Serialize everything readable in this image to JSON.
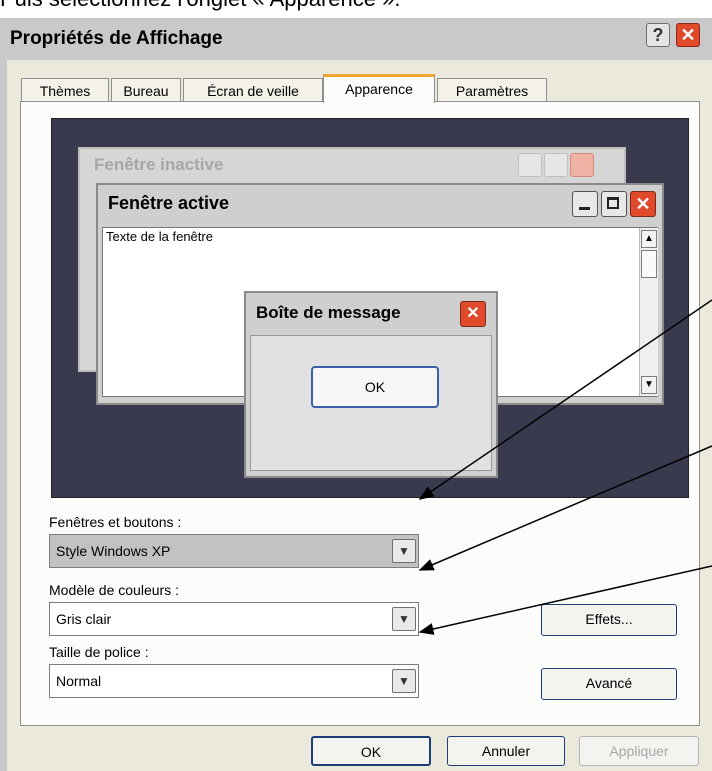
{
  "caption": "Puis sélectionnez l'onglet « Apparence ».",
  "window": {
    "title": "Propriétés de Affichage",
    "help_label": "?",
    "close_label": "✕"
  },
  "tabs": [
    {
      "label": "Thèmes"
    },
    {
      "label": "Bureau"
    },
    {
      "label": "Écran de veille"
    },
    {
      "label": "Apparence",
      "active": true
    },
    {
      "label": "Paramètres"
    }
  ],
  "preview": {
    "inactive_title": "Fenêtre inactive",
    "active_title": "Fenêtre active",
    "active_text": "Texte de la fenêtre",
    "message_title": "Boîte de message",
    "message_ok": "OK"
  },
  "form": {
    "windows_buttons_label": "Fenêtres et boutons :",
    "windows_buttons_value": "Style Windows XP",
    "color_scheme_label": "Modèle de couleurs :",
    "color_scheme_value": "Gris clair",
    "font_size_label": "Taille de police :",
    "font_size_value": "Normal"
  },
  "buttons": {
    "effects": "Effets...",
    "advanced": "Avancé",
    "ok": "OK",
    "cancel": "Annuler",
    "apply": "Appliquer"
  },
  "icons": {
    "help": "question-icon",
    "close": "close-icon",
    "minimize": "minimize-icon",
    "maximize": "maximize-icon",
    "dropdown": "chevron-down-icon"
  },
  "colors": {
    "close_red": "#e04a2b",
    "tab_accent": "#f0a533",
    "preview_desktop": "#3a3a4e",
    "button_border": "#1c3d78"
  }
}
